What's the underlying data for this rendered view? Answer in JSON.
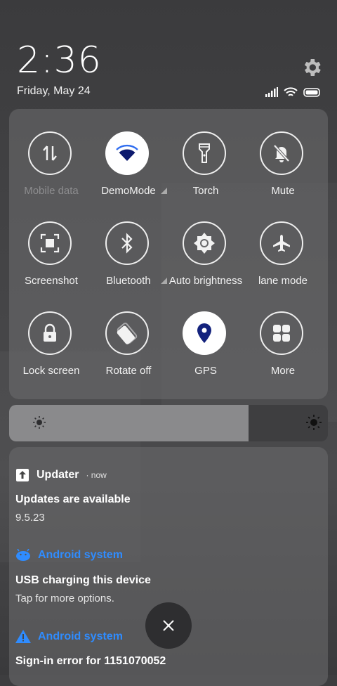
{
  "header": {
    "time": "2:36",
    "date": "Friday, May 24"
  },
  "quick_settings": [
    {
      "label": "Mobile data",
      "icon": "mobile-data-icon",
      "active": false,
      "dim": true
    },
    {
      "label": "DemoMode",
      "icon": "wifi-icon",
      "active": true,
      "dim": false
    },
    {
      "label": "Torch",
      "icon": "torch-icon",
      "active": false,
      "dim": false
    },
    {
      "label": "Mute",
      "icon": "mute-bell-icon",
      "active": false,
      "dim": false
    },
    {
      "label": "Screenshot",
      "icon": "screenshot-icon",
      "active": false,
      "dim": false
    },
    {
      "label": "Bluetooth",
      "icon": "bluetooth-icon",
      "active": false,
      "dim": false
    },
    {
      "label": "Auto brightness",
      "icon": "auto-brightness-icon",
      "active": false,
      "dim": false
    },
    {
      "label": "lane mode",
      "icon": "airplane-icon",
      "active": false,
      "dim": false
    },
    {
      "label": "Lock screen",
      "icon": "lock-icon",
      "active": false,
      "dim": false
    },
    {
      "label": "Rotate off",
      "icon": "rotate-icon",
      "active": false,
      "dim": false
    },
    {
      "label": "GPS",
      "icon": "location-pin-icon",
      "active": true,
      "dim": false
    },
    {
      "label": "More",
      "icon": "grid-icon",
      "active": false,
      "dim": false
    }
  ],
  "brightness": {
    "level": 0.75
  },
  "notifications": [
    {
      "app": "Updater",
      "time": "now",
      "title": "Updates are available",
      "text": "9.5.23"
    },
    {
      "app": "Android system",
      "title": "USB charging this device",
      "text": "Tap for more options."
    },
    {
      "app": "Android system",
      "title": "Sign-in error for 1151070052"
    }
  ],
  "colors": {
    "accent": "#2f8cff",
    "active_icon": "#1a237e"
  }
}
